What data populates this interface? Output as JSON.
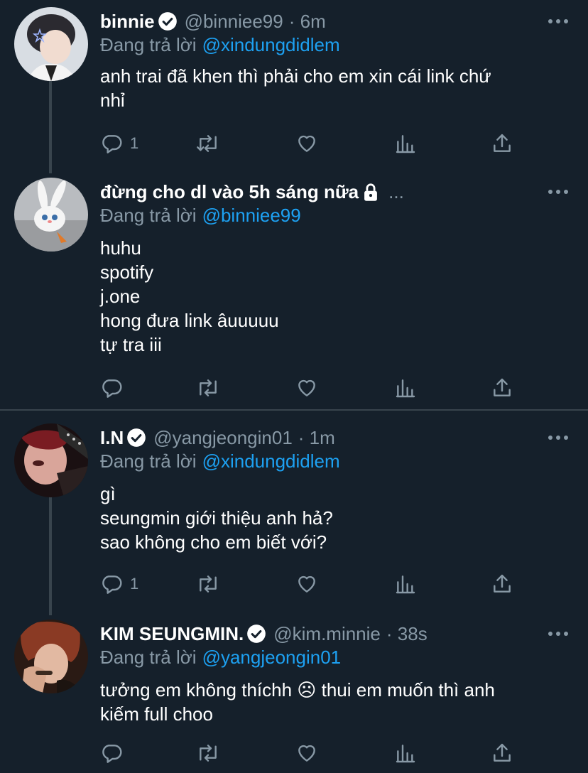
{
  "tweets": [
    {
      "name": "binnie",
      "verified": true,
      "handle": "@binniee99",
      "time": "· 6m",
      "replying_label": "Đang trả lời",
      "replying_to": "@xindungdidlem",
      "lines": [
        "anh trai đã khen thì phải cho em xin cái link chứ",
        "nhỉ"
      ],
      "reply_count": "1"
    },
    {
      "name": "đừng cho dl vào 5h sáng nữa",
      "locked": true,
      "trail": "...",
      "replying_label": "Đang trả lời",
      "replying_to": "@binniee99",
      "lines": [
        "huhu",
        "spotify",
        "j.one",
        "hong đưa link âuuuuu",
        "tự tra iii"
      ],
      "reply_count": ""
    },
    {
      "name": "I.N",
      "verified": true,
      "handle": "@yangjeongin01",
      "time": "· 1m",
      "replying_label": "Đang trả lời",
      "replying_to": "@xindungdidlem",
      "lines": [
        "gì",
        "seungmin giới thiệu anh hả?",
        "sao không cho em biết với?"
      ],
      "reply_count": "1"
    },
    {
      "name": "KIM SEUNGMIN.",
      "verified": true,
      "handle": "@kim.minnie",
      "time": "· 38s",
      "replying_label": "Đang trả lời",
      "replying_to": "@yangjeongin01",
      "lines": [
        "tưởng em không thíchh ☹ thui em muốn thì anh",
        "kiếm full choo"
      ],
      "reply_count": ""
    }
  ],
  "icons": {
    "reply": "reply-icon",
    "retweet": "retweet-icon",
    "like": "heart-icon",
    "analytics": "analytics-icon",
    "share": "share-icon",
    "more": "more-options-icon",
    "verified": "verified-badge-icon",
    "lock": "lock-icon"
  },
  "colors": {
    "background": "#15202b",
    "text": "#ffffff",
    "muted": "#8899a6",
    "accent": "#1da1f2",
    "divider": "#38444d"
  }
}
